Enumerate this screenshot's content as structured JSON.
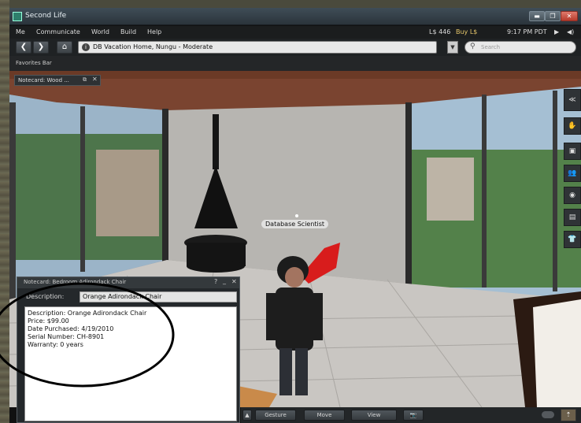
{
  "window": {
    "title": "Second Life",
    "min_label": "▬",
    "max_label": "❐",
    "close_label": "✕"
  },
  "menubar": {
    "items": [
      "Me",
      "Communicate",
      "World",
      "Build",
      "Help"
    ],
    "balance": "L$ 446",
    "buy_currency": "Buy L$",
    "time": "9:17 PM PDT",
    "media_icon": "play-icon",
    "volume_icon": "volume-icon"
  },
  "navbar": {
    "back": "❮",
    "forward": "❯",
    "home": "⌂",
    "info": "i",
    "location": "DB Vacation Home, Nungu - Moderate",
    "dropdown": "▼",
    "search_placeholder": "Search"
  },
  "favorites_bar": {
    "label": "Favorites Bar"
  },
  "notecard_tab": {
    "label": "Notecard: Wood ...",
    "popout": "⧉",
    "close": "✕"
  },
  "scene": {
    "avatar_name": "Database Scientist"
  },
  "right_sidebar": {
    "buttons": [
      "≪",
      "✋",
      "▣",
      "👥",
      "◉",
      "▤",
      "👕"
    ]
  },
  "notecard": {
    "title": "Notecard: Bedroom Adirondack Chair",
    "help": "?",
    "minimize": "_",
    "close": "✕",
    "description_label": "Description:",
    "description_value": "Orange Adirondack Chair",
    "lines": [
      "Description: Orange Adirondack Chair",
      "Price: $99.00",
      "Date Purchased: 4/19/2010",
      "Serial Number: CH-8901",
      "Warranty: 0 years"
    ]
  },
  "bottom_toolbar": {
    "chat_toggle": "▲",
    "gesture": "Gesture",
    "move": "Move",
    "view": "View",
    "snapshot": "📷",
    "speak": "⇡"
  }
}
